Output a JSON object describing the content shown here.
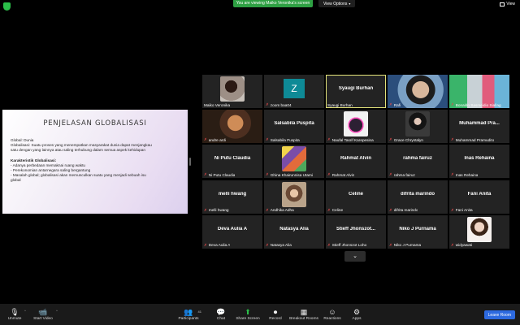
{
  "banner": "You are viewing Maiko Veronika's screen",
  "view_options": "View Options",
  "view_button": "View",
  "share": {
    "title": "PENJELASAN GLOBALISASI",
    "lines": [
      "Global: Dunia",
      "Globalisasi: Suatu proses yang menempatkan masyarakat dunia dapat menjangkau",
      "satu dengan yang lainnya atau saling terhubung dalam semua aspek kehidupan"
    ],
    "subhead": "Karakteristik Globalisasi:",
    "bullets": [
      "- Adanya perbedaan memaknai ruang waktu",
      "- Perekonomian antarnegara saling bergantung",
      "- Masalah global; globalisasi akan memunculkan suatu yang menjadi sebuah isu",
      "global"
    ]
  },
  "tiles": [
    {
      "label": "Maiko Veronika",
      "center": "",
      "kind": "photo",
      "photo": "ph1",
      "muted": false,
      "active": false
    },
    {
      "label": "zoom baa04",
      "center": "",
      "kind": "avatar",
      "avatar": "Z",
      "muted": true,
      "active": false
    },
    {
      "label": "Syaugi Burhan",
      "center": "Syaugi Burhan",
      "kind": "name",
      "muted": false,
      "active": true
    },
    {
      "label": "Rafi",
      "center": "",
      "kind": "wide",
      "photo": "ph2",
      "muted": true,
      "active": false
    },
    {
      "label": "Bonaldo Sasmeidio Siallag",
      "center": "",
      "kind": "wide",
      "photo": "ph3",
      "muted": true,
      "active": false
    },
    {
      "label": "andre ardi",
      "center": "",
      "kind": "wide",
      "photo": "ph4",
      "muted": true,
      "active": false
    },
    {
      "label": "Salsabila Puspita",
      "center": "Salsabila Puspita",
      "kind": "name",
      "muted": true,
      "active": false
    },
    {
      "label": "Naufal Tasrif Karepesina",
      "center": "",
      "kind": "photo",
      "photo": "ph5",
      "muted": true,
      "active": false
    },
    {
      "label": "Grace Chrystalyn",
      "center": "",
      "kind": "photo",
      "photo": "ph6",
      "muted": true,
      "active": false
    },
    {
      "label": "Muhammad Pramudito",
      "center": "Muhammad Pra...",
      "kind": "name",
      "muted": true,
      "active": false
    },
    {
      "label": "Ni Putu Claudia",
      "center": "Ni Putu Claudia",
      "kind": "name",
      "muted": true,
      "active": false
    },
    {
      "label": "Ghina Khairunnisa Utami",
      "center": "",
      "kind": "photo",
      "photo": "ph7",
      "muted": true,
      "active": false
    },
    {
      "label": "Rahmat Alvin",
      "center": "Rahmat Alvin",
      "kind": "name",
      "muted": true,
      "active": false
    },
    {
      "label": "rahma fairuz",
      "center": "rahma fairuz",
      "kind": "name",
      "muted": true,
      "active": false
    },
    {
      "label": "Inas Rehaina",
      "center": "Inas Rehaina",
      "kind": "name",
      "muted": true,
      "active": false
    },
    {
      "label": "melli hwang",
      "center": "melli hwang",
      "kind": "name",
      "muted": true,
      "active": false
    },
    {
      "label": "Andhika Adha",
      "center": "",
      "kind": "photo",
      "photo": "ph8",
      "muted": true,
      "active": false
    },
    {
      "label": "Celine",
      "center": "Celine",
      "kind": "name",
      "muted": true,
      "active": false
    },
    {
      "label": "difrita marindo",
      "center": "difrita marindo",
      "kind": "name",
      "muted": true,
      "active": false
    },
    {
      "label": "Fani Anita",
      "center": "Fani Anita",
      "kind": "name",
      "muted": true,
      "active": false
    },
    {
      "label": "Deva Aulia A",
      "center": "Deva Aulia A",
      "kind": "name",
      "muted": true,
      "active": false
    },
    {
      "label": "Natasya Alia",
      "center": "Natasya Alia",
      "kind": "name",
      "muted": true,
      "active": false
    },
    {
      "label": "Stieff Jhonszot Loho",
      "center": "Stieff Jhonszot...",
      "kind": "name",
      "muted": true,
      "active": false
    },
    {
      "label": "Niko J Purnama",
      "center": "Niko J Purnama",
      "kind": "name",
      "muted": true,
      "active": false
    },
    {
      "label": "widyawati",
      "center": "",
      "kind": "photo",
      "photo": "ph9",
      "muted": true,
      "active": false
    }
  ],
  "toolbar": {
    "unmute": "Unmute",
    "start_video": "Start Video",
    "participants": "Participants",
    "participants_count": "41",
    "chat": "Chat",
    "share_screen": "Share Screen",
    "record": "Record",
    "breakout_rooms": "Breakout Rooms",
    "reactions": "Reactions",
    "apps": "Apps",
    "leave": "Leave Room"
  }
}
